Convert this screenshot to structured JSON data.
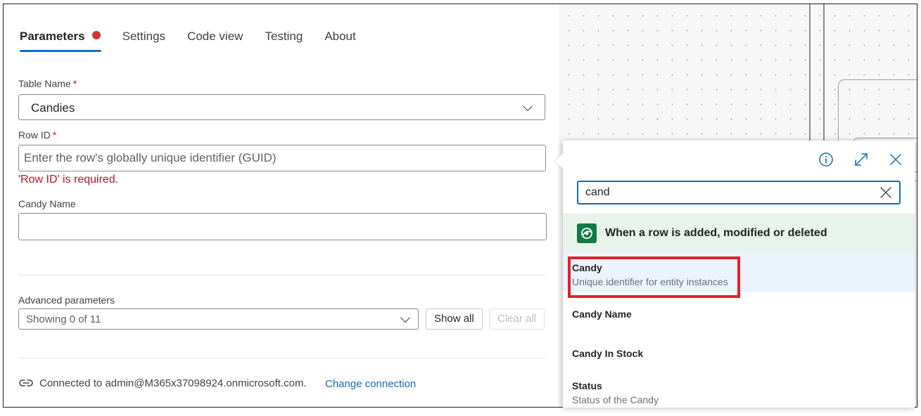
{
  "tabs": [
    {
      "label": "Parameters",
      "active": true,
      "has_error_dot": true
    },
    {
      "label": "Settings",
      "active": false
    },
    {
      "label": "Code view",
      "active": false
    },
    {
      "label": "Testing",
      "active": false
    },
    {
      "label": "About",
      "active": false
    }
  ],
  "form": {
    "table_name": {
      "label": "Table Name",
      "required_mark": "*",
      "value": "Candies"
    },
    "row_id": {
      "label": "Row ID",
      "required_mark": "*",
      "placeholder": "Enter the row's globally unique identifier (GUID)",
      "error": "'Row ID' is required."
    },
    "candy_name": {
      "label": "Candy Name",
      "value": ""
    }
  },
  "advanced": {
    "label": "Advanced parameters",
    "value": "Showing 0 of 11",
    "show_all": "Show all",
    "clear_all": "Clear all"
  },
  "connection": {
    "text": "Connected to admin@M365x37098924.onmicrosoft.com.",
    "link": "Change connection"
  },
  "dynamic_content": {
    "search_value": "cand",
    "icons": [
      "info-icon",
      "expand-icon",
      "close-icon",
      "clear-search-icon",
      "dataverse-icon",
      "link-icon"
    ],
    "group_title": "When a row is added, modified or deleted",
    "items": [
      {
        "name": "Candy",
        "description": "Unique identifier for entity instances",
        "selected": true
      },
      {
        "name": "Candy Name",
        "description": ""
      },
      {
        "name": "Candy In Stock",
        "description": ""
      },
      {
        "name": "Status",
        "description": "Status of the Candy"
      }
    ]
  },
  "colors": {
    "accent": "#0f6cbd",
    "error": "#c50f1f",
    "dataverse_green": "#107c41",
    "group_bg": "#e8f3eb",
    "selected_bg": "#ebf3fc",
    "annotation_red": "#e3202f"
  }
}
